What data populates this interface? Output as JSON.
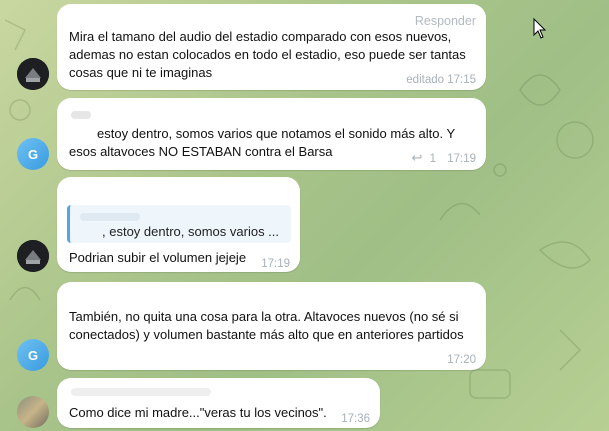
{
  "messages": [
    {
      "text": "Mira el tamano del audio del estadio comparado con esos nuevos, ademas no estan colocados en todo el estadio, eso puede ser tantas cosas que ni te imaginas",
      "status": "editado",
      "time": "17:15",
      "reply_label": "Responder"
    },
    {
      "avatar_letter": "G",
      "text": "estoy dentro, somos varios que notamos el sonido más alto. Y esos altavoces NO ESTABAN contra el Barsa",
      "reactions_count": "1",
      "time": "17:19"
    },
    {
      "quote": ", estoy dentro, somos varios ...",
      "text": "Podrian subir el volumen jejeje",
      "time": "17:19"
    },
    {
      "avatar_letter": "G",
      "text": "También, no quita una cosa para la otra. Altavoces nuevos (no sé si conectados) y volumen bastante más alto que en anteriores partidos",
      "time": "17:20"
    },
    {
      "text": "Como dice mi madre...\"veras tu los vecinos\".",
      "time": "17:36"
    }
  ],
  "colors": {
    "bubble": "#ffffff",
    "meta": "#a8b0b8",
    "accent": "#53a6e0",
    "avatar_blue": "#4fb0ea"
  }
}
